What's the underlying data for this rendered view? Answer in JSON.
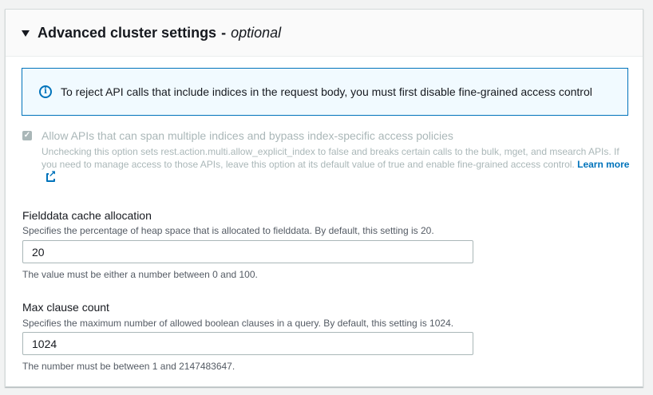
{
  "header": {
    "title": "Advanced cluster settings",
    "dash": "-",
    "optional": "optional"
  },
  "alert": {
    "icon": "info-icon",
    "text": "To reject API calls that include indices in the request body, you must first disable fine-grained access control"
  },
  "multi_index": {
    "checked": true,
    "label": "Allow APIs that can span multiple indices and bypass index-specific access policies",
    "description": "Unchecking this option sets rest.action.multi.allow_explicit_index to false and breaks certain calls to the bulk, mget, and msearch APIs. If you need to manage access to those APIs, leave this option at its default value of true and enable fine-grained access control.",
    "learn_more": "Learn more"
  },
  "fielddata": {
    "label": "Fielddata cache allocation",
    "description": "Specifies the percentage of heap space that is allocated to fielddata. By default, this setting is 20.",
    "value": "20",
    "constraint": "The value must be either a number between 0 and 100."
  },
  "max_clause": {
    "label": "Max clause count",
    "description": "Specifies the maximum number of allowed boolean clauses in a query. By default, this setting is 1024.",
    "value": "1024",
    "constraint": "The number must be between 1 and 2147483647."
  },
  "colors": {
    "link": "#0073bb",
    "alert_bg": "#f1faff",
    "disabled_text": "#aab7b8"
  }
}
